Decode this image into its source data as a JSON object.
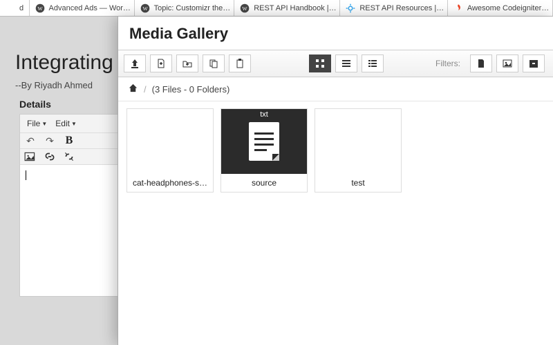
{
  "tabs": [
    {
      "label": "d",
      "icon": "generic"
    },
    {
      "label": "Advanced Ads — Wor…",
      "icon": "wp"
    },
    {
      "label": "Topic: Customizr the…",
      "icon": "wp"
    },
    {
      "label": "REST API Handbook |…",
      "icon": "wp"
    },
    {
      "label": "REST API Resources |…",
      "icon": "gear"
    },
    {
      "label": "Awesome Codeigniter…",
      "icon": "ci"
    }
  ],
  "page": {
    "title": "Integrating",
    "byline": "--By Riyadh Ahmed",
    "details_label": "Details",
    "editor": {
      "file": "File",
      "edit": "Edit"
    }
  },
  "modal": {
    "title": "Media Gallery",
    "filters_label": "Filters:",
    "breadcrumb_summary": "(3 Files - 0 Folders)",
    "items": [
      {
        "name": "cat-headphones-s…",
        "type": "image"
      },
      {
        "name": "source",
        "type": "txt",
        "badge": "txt"
      },
      {
        "name": "test",
        "type": "image"
      }
    ]
  }
}
